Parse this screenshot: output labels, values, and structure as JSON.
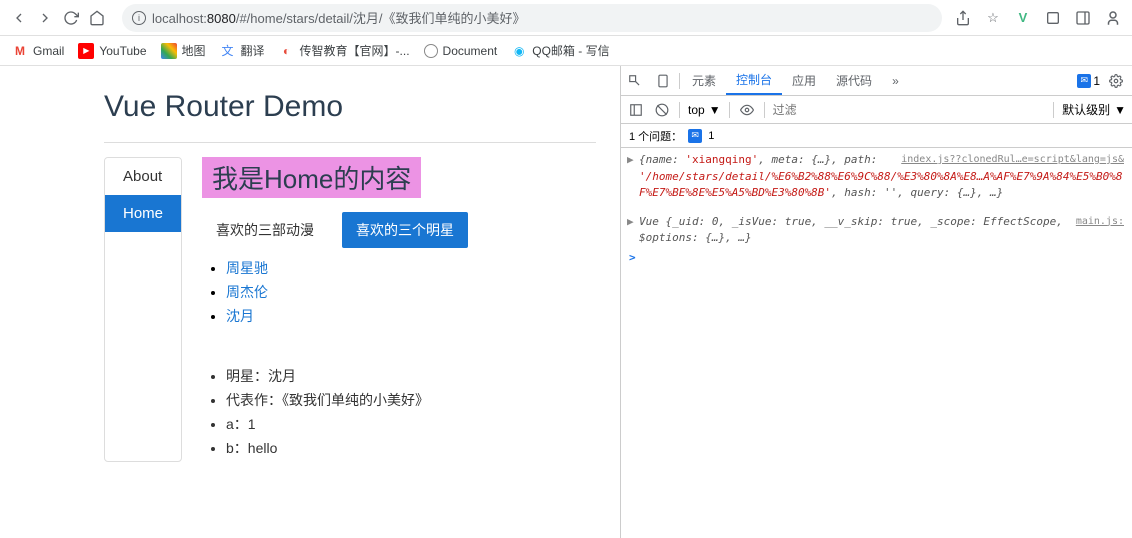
{
  "browser": {
    "url_host": "localhost:",
    "url_port": "8080",
    "url_path": "/#/home/stars/detail/沈月/《致我们单纯的小美好》"
  },
  "bookmarks": [
    {
      "label": "Gmail"
    },
    {
      "label": "YouTube"
    },
    {
      "label": "地图"
    },
    {
      "label": "翻译"
    },
    {
      "label": "传智教育【官网】-..."
    },
    {
      "label": "Document"
    },
    {
      "label": "QQ邮箱 - 写信"
    }
  ],
  "page": {
    "title": "Vue Router Demo",
    "sidebar": [
      {
        "label": "About",
        "active": false
      },
      {
        "label": "Home",
        "active": true
      }
    ],
    "heading": "我是Home的内容",
    "tabs": [
      {
        "label": "喜欢的三部动漫",
        "active": false
      },
      {
        "label": "喜欢的三个明星",
        "active": true
      }
    ],
    "stars": [
      "周星驰",
      "周杰伦",
      "沈月"
    ],
    "details": [
      "明星：沈月",
      "代表作：《致我们单纯的小美好》",
      "a：1",
      "b：hello"
    ]
  },
  "devtools": {
    "tabs": [
      "元素",
      "控制台",
      "应用",
      "源代码"
    ],
    "active_tab": "控制台",
    "more": "»",
    "errors_badge": "1",
    "context": "top",
    "filter_placeholder": "过滤",
    "levels_label": "默认级别",
    "issues_text": "1 个问题：",
    "issues_count": "1",
    "log1_src": "index.js??clonedRul…e=script&lang=js&",
    "log1_pre": "{name: ",
    "log1_name": "'xiangqing'",
    "log1_meta": ", meta: {…}, path: ",
    "log1_path": "'/home/stars/detail/%E6%B2%88%E6%9C%88/%E3%80%8A%E8…A%AF%E7%9A%84%E5%B0%8F%E7%BE%8E%E5%A5%BD%E3%80%8B'",
    "log1_tail": ", hash: '', query: {…}, …}",
    "log2_src": "main.js:",
    "log2_text": "Vue {_uid: 0, _isVue: true, __v_skip: true, _scope: EffectScope, $options: {…}, …}",
    "prompt": ">"
  }
}
